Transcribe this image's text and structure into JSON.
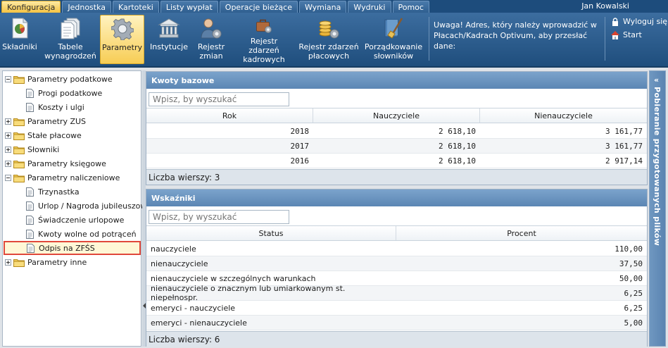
{
  "menu": {
    "tabs": [
      "Konfiguracja",
      "Jednostka",
      "Kartoteki",
      "Listy wypłat",
      "Operacje bieżące",
      "Wymiana",
      "Wydruki",
      "Pomoc"
    ],
    "active_tab": "Konfiguracja",
    "user": "Jan Kowalski"
  },
  "ribbon": {
    "buttons": [
      {
        "label": "Składniki",
        "icon": "document-chart-icon"
      },
      {
        "label": "Tabele wynagrodzeń",
        "icon": "documents-stack-icon"
      },
      {
        "label": "Parametry",
        "icon": "gear-icon",
        "active": true
      },
      {
        "label": "Instytucje",
        "icon": "building-icon"
      },
      {
        "label": "Rejestr zmian",
        "icon": "user-gear-icon"
      },
      {
        "label": "Rejestr zdarzeń kadrowych",
        "icon": "briefcase-gear-icon"
      },
      {
        "label": "Rejestr zdarzeń płacowych",
        "icon": "coins-gear-icon"
      },
      {
        "label": "Porządkowanie słowników",
        "icon": "book-broom-icon"
      }
    ],
    "notice": "Uwaga! Adres, który należy wprowadzić w Płacach/Kadrach Optivum, aby przesłać dane:",
    "logout": "Wyloguj się",
    "start": "Start"
  },
  "tree": {
    "items": [
      {
        "label": "Parametry podatkowe",
        "level": 0,
        "expanded": true
      },
      {
        "label": "Progi podatkowe",
        "level": 1
      },
      {
        "label": "Koszty i ulgi",
        "level": 1
      },
      {
        "label": "Parametry ZUS",
        "level": 0,
        "expanded": false
      },
      {
        "label": "Stałe płacowe",
        "level": 0,
        "expanded": false
      },
      {
        "label": "Słowniki",
        "level": 0,
        "expanded": false
      },
      {
        "label": "Parametry księgowe",
        "level": 0,
        "expanded": false
      },
      {
        "label": "Parametry naliczeniowe",
        "level": 0,
        "expanded": true
      },
      {
        "label": "Trzynastka",
        "level": 1
      },
      {
        "label": "Urlop / Nagroda jubileuszowa",
        "level": 1
      },
      {
        "label": "Świadczenie urlopowe",
        "level": 1
      },
      {
        "label": "Kwoty wolne od potrąceń",
        "level": 1
      },
      {
        "label": "Odpis na ZFŚS",
        "level": 1,
        "selected": true
      },
      {
        "label": "Parametry inne",
        "level": 0,
        "expanded": false
      }
    ]
  },
  "kwoty": {
    "title": "Kwoty bazowe",
    "search_placeholder": "Wpisz, by wyszukać",
    "columns": [
      "Rok",
      "Nauczyciele",
      "Nienauczyciele"
    ],
    "rows": [
      [
        "2018",
        "2 618,10",
        "3 161,77"
      ],
      [
        "2017",
        "2 618,10",
        "3 161,77"
      ],
      [
        "2016",
        "2 618,10",
        "2 917,14"
      ]
    ],
    "footer": "Liczba wierszy: 3"
  },
  "wskazniki": {
    "title": "Wskaźniki",
    "search_placeholder": "Wpisz, by wyszukać",
    "columns": [
      "Status",
      "Procent"
    ],
    "rows": [
      [
        "nauczyciele",
        "110,00"
      ],
      [
        "nienauczyciele",
        "37,50"
      ],
      [
        "nienauczyciele w szczególnych warunkach",
        "50,00"
      ],
      [
        "nienauczyciele o znacznym lub umiarkowanym st. niepełnospr.",
        "6,25"
      ],
      [
        "emeryci - nauczyciele",
        "6,25"
      ],
      [
        "emeryci - nienauczyciele",
        "5,00"
      ]
    ],
    "footer": "Liczba wierszy: 6"
  },
  "right_pane": {
    "label": "Pobieranie przygotowanych plików"
  }
}
